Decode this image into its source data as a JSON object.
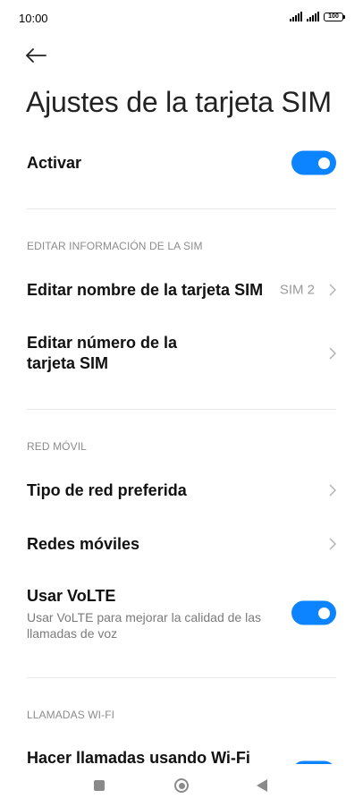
{
  "status_bar": {
    "time": "10:00",
    "battery": "100"
  },
  "title": "Ajustes de la tarjeta SIM",
  "activate": {
    "label": "Activar",
    "enabled": true
  },
  "sections": {
    "sim_info": {
      "header": "EDITAR INFORMACIÓN DE LA SIM",
      "edit_name": {
        "label": "Editar nombre de la tarjeta SIM",
        "value": "SIM 2"
      },
      "edit_number": {
        "label_line1": "Editar número de la",
        "label_line2": "tarjeta SIM"
      }
    },
    "mobile_network": {
      "header": "RED MÓVIL",
      "preferred_network": {
        "label": "Tipo de red preferida"
      },
      "mobile_networks": {
        "label": "Redes móviles"
      },
      "volte": {
        "label": "Usar VoLTE",
        "sub_line1": "Usar VoLTE para mejorar la calidad de las",
        "sub_line2": "llamadas de voz",
        "enabled": true
      }
    },
    "wifi_calls": {
      "header": "LLAMADAS WI-FI",
      "wifi_calling": {
        "label": "Hacer llamadas usando Wi-Fi",
        "enabled": true
      }
    }
  },
  "colors": {
    "accent": "#0d84ff",
    "secondary_text": "#7a7a7a",
    "divider": "#e8e8e8"
  },
  "icons": {
    "back": "arrow-left-icon",
    "chevron": "chevron-right-icon",
    "nav": [
      "recents-icon",
      "home-icon",
      "back-triangle-icon"
    ]
  }
}
